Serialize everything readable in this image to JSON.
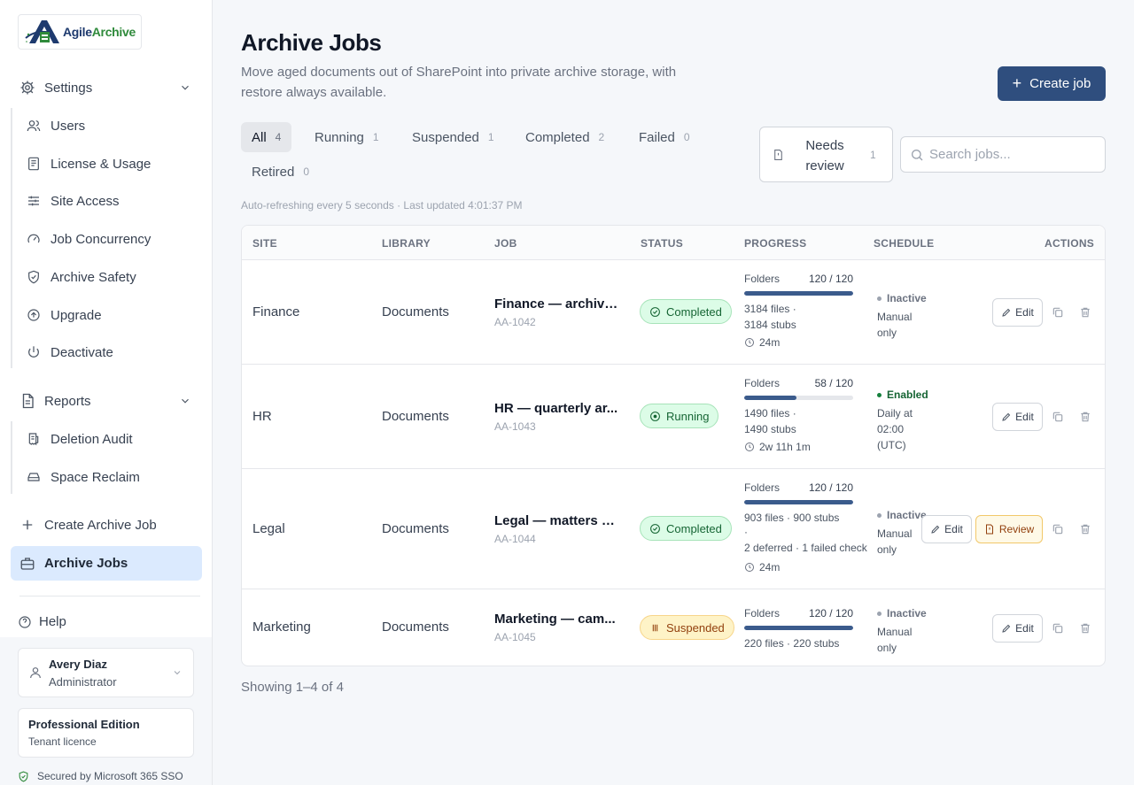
{
  "brand": {
    "part1": "Agile",
    "part2": "Archive"
  },
  "sidebar": {
    "settings_label": "Settings",
    "settings_items": [
      {
        "label": "Users",
        "icon": "users-icon"
      },
      {
        "label": "License & Usage",
        "icon": "license-icon"
      },
      {
        "label": "Site Access",
        "icon": "sliders-icon"
      },
      {
        "label": "Job Concurrency",
        "icon": "gauge-icon"
      },
      {
        "label": "Archive Safety",
        "icon": "shield-check-icon"
      },
      {
        "label": "Upgrade",
        "icon": "arrow-up-circle-icon"
      },
      {
        "label": "Deactivate",
        "icon": "power-icon"
      }
    ],
    "reports_label": "Reports",
    "reports_items": [
      {
        "label": "Deletion Audit",
        "icon": "receipt-icon"
      },
      {
        "label": "Space Reclaim",
        "icon": "hard-drive-icon"
      }
    ],
    "create_label": "Create Archive Job",
    "jobs_label": "Archive Jobs",
    "help_label": "Help",
    "user": {
      "name": "Avery Diaz",
      "role": "Administrator"
    },
    "edition": {
      "name": "Professional Edition",
      "sub": "Tenant licence"
    },
    "secured": "Secured by Microsoft 365 SSO"
  },
  "header": {
    "title": "Archive Jobs",
    "subtitle": "Move aged documents out of SharePoint into private archive storage, with restore always available.",
    "create_button": "Create job"
  },
  "tabs": [
    {
      "label": "All",
      "count": "4"
    },
    {
      "label": "Running",
      "count": "1"
    },
    {
      "label": "Suspended",
      "count": "1"
    },
    {
      "label": "Completed",
      "count": "2"
    },
    {
      "label": "Failed",
      "count": "0"
    },
    {
      "label": "Retired",
      "count": "0"
    }
  ],
  "needs_review": {
    "label": "Needs review",
    "count": "1"
  },
  "search": {
    "placeholder": "Search jobs..."
  },
  "refresh_note": "Auto-refreshing every 5 seconds · Last updated 4:01:37 PM",
  "table": {
    "headers": [
      "SITE",
      "LIBRARY",
      "JOB",
      "STATUS",
      "PROGRESS",
      "SCHEDULE",
      "ACTIONS"
    ],
    "rows": [
      {
        "site": "Finance",
        "library": "Documents",
        "job_name": "Finance — archive ...",
        "job_id": "AA-1042",
        "status": "Completed",
        "progress_label": "Folders",
        "progress_value": "120 / 120",
        "progress_fraction": 1.0,
        "files_line1": "3184 files  ·",
        "files_line2": "3184 stubs",
        "extra": "",
        "duration": "24m",
        "schedule_state": "Inactive",
        "schedule_text": "Manual only",
        "edit_label": "Edit"
      },
      {
        "site": "HR",
        "library": "Documents",
        "job_name": "HR — quarterly ar...",
        "job_id": "AA-1043",
        "status": "Running",
        "progress_label": "Folders",
        "progress_value": "58 / 120",
        "progress_fraction": 0.48,
        "files_line1": "1490 files  ·",
        "files_line2": "1490 stubs",
        "extra": "",
        "duration": "2w 11h 1m",
        "schedule_state": "Enabled",
        "schedule_text": "Daily at 02:00 (UTC)",
        "edit_label": "Edit"
      },
      {
        "site": "Legal",
        "library": "Documents",
        "job_name": "Legal — matters b...",
        "job_id": "AA-1044",
        "status": "Completed",
        "progress_label": "Folders",
        "progress_value": "120 / 120",
        "progress_fraction": 1.0,
        "files_line1": "903 files  ·  900 stubs",
        "files_line2": "·",
        "extra": "2 deferred · 1 failed check",
        "duration": "24m",
        "schedule_state": "Inactive",
        "schedule_text": "Manual only",
        "edit_label": "Edit",
        "review_label": "Review"
      },
      {
        "site": "Marketing",
        "library": "Documents",
        "job_name": "Marketing — cam...",
        "job_id": "AA-1045",
        "status": "Suspended",
        "progress_label": "Folders",
        "progress_value": "120 / 120",
        "progress_fraction": 1.0,
        "files_line1": "220 files  ·  220 stubs",
        "files_line2": "",
        "extra": "",
        "duration": "",
        "schedule_state": "Inactive",
        "schedule_text": "Manual only",
        "edit_label": "Edit"
      }
    ]
  },
  "footer": {
    "showing": "Showing 1–4 of 4"
  },
  "colors": {
    "primary": "#2f4e7e",
    "active_nav": "#dbeafe",
    "success": "#166534",
    "warning": "#92400e"
  }
}
